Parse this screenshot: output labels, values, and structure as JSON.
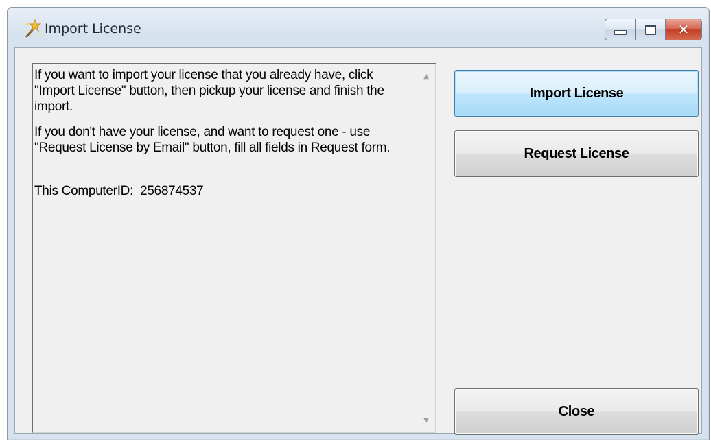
{
  "window": {
    "title": "Import License",
    "app_icon": "wand-icon",
    "caption_buttons": [
      "minimize",
      "maximize",
      "close"
    ]
  },
  "info": {
    "paragraph1": "If you want to import your license that you already have, click \"Import License\" button, then pickup your license and finish the import.",
    "paragraph2": "If you don't have your license, and want to request one - use \"Request License by Email\" button, fill all fields in Request form.",
    "computer_id_label": "This ComputerID:",
    "computer_id_value": "256874537"
  },
  "buttons": {
    "import_label": "Import License",
    "request_label": "Request License",
    "close_label": "Close"
  },
  "colors": {
    "focused_button": "#bee6fd",
    "close_caption": "#c33f26",
    "client_bg": "#f0f0f0"
  }
}
